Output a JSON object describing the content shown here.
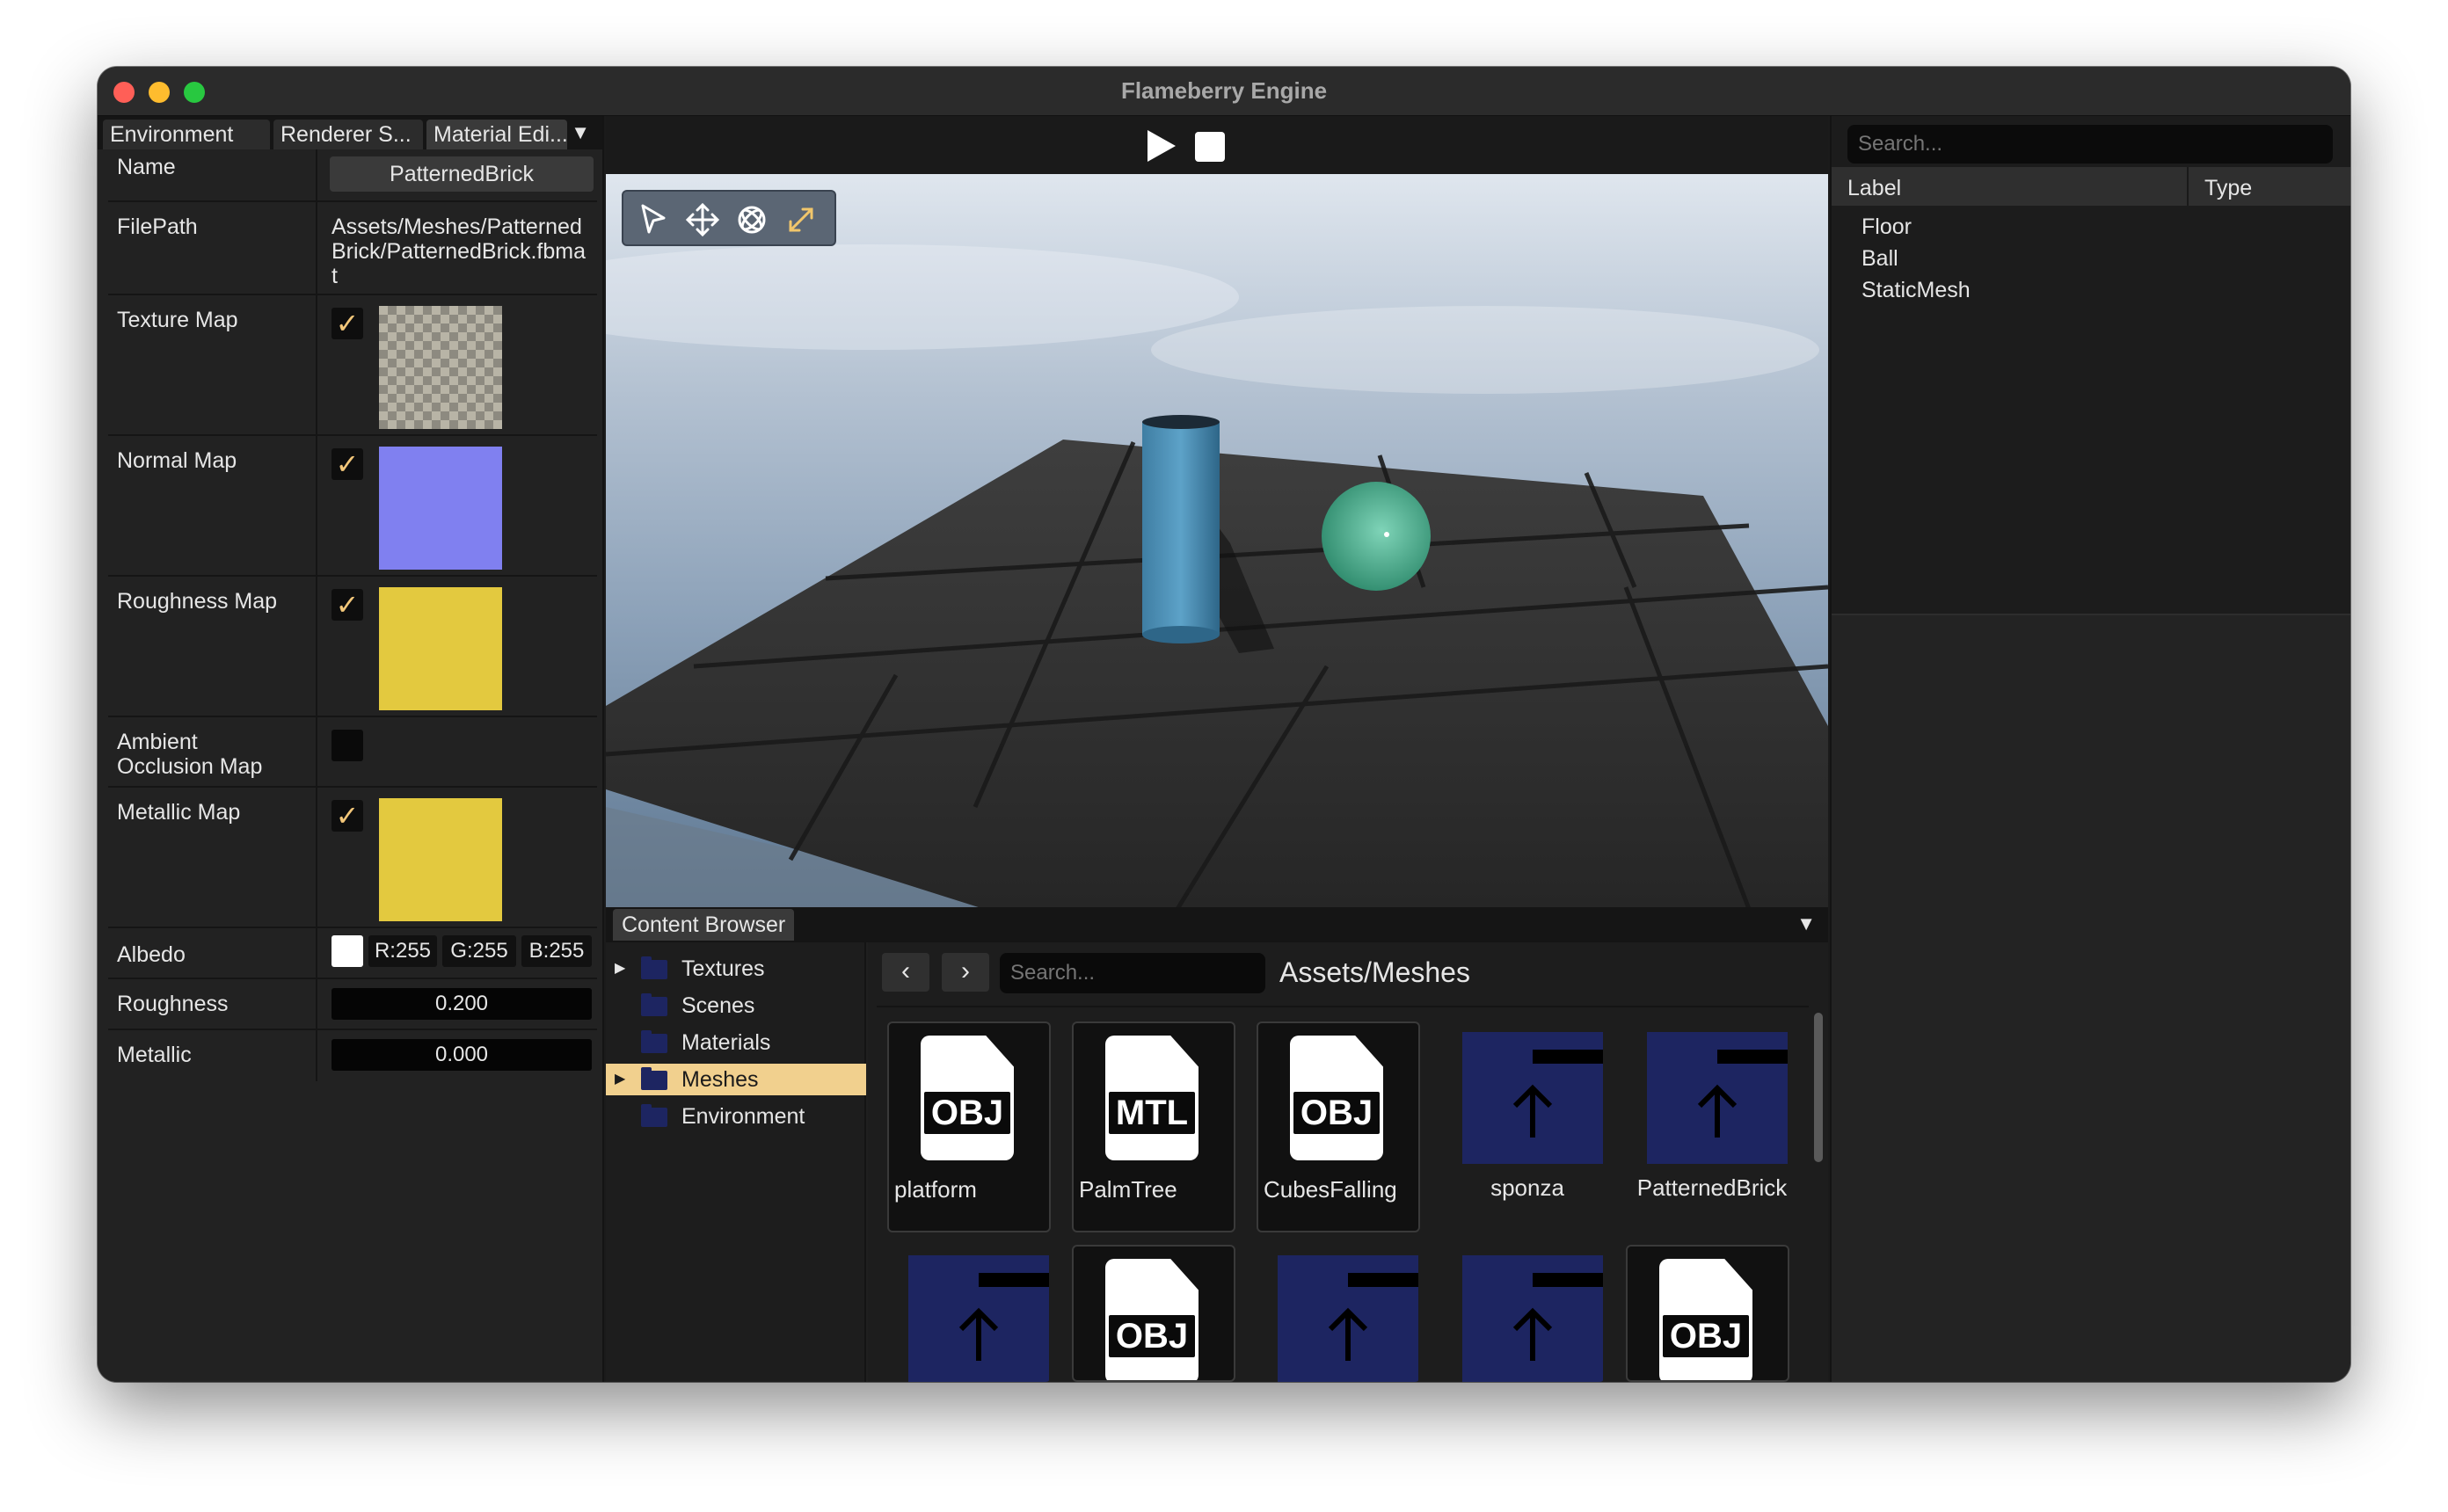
{
  "window": {
    "title": "Flameberry Engine"
  },
  "left_panel": {
    "tabs": [
      "Environment",
      "Renderer S...",
      "Material Edi..."
    ],
    "properties": {
      "name_label": "Name",
      "name_value": "PatternedBrick",
      "filepath_label": "FilePath",
      "filepath_value": "Assets/Meshes/PatternedBrick/PatternedBrick.fbmat",
      "texture_map_label": "Texture Map",
      "normal_map_label": "Normal Map",
      "roughness_map_label": "Roughness Map",
      "ao_map_label": "Ambient Occlusion Map",
      "metallic_map_label": "Metallic Map",
      "albedo_label": "Albedo",
      "albedo_r": "R:255",
      "albedo_g": "G:255",
      "albedo_b": "B:255",
      "roughness_label": "Roughness",
      "roughness_value": "0.200",
      "metallic_label": "Metallic",
      "metallic_value": "0.000"
    },
    "checkmark": "✓",
    "colors": {
      "normal_map": "#8080f0",
      "roughness_map": "#e3c93f",
      "metallic_map": "#e3c93f"
    }
  },
  "viewport": {
    "toolbar": {
      "play_icon": "play-icon",
      "stop_icon": "stop-icon"
    },
    "gizmos": [
      "select-icon",
      "move-icon",
      "rotate-icon",
      "scale-icon"
    ]
  },
  "content_browser": {
    "tab_label": "Content Browser",
    "tree": [
      "Textures",
      "Scenes",
      "Materials",
      "Meshes",
      "Environment"
    ],
    "search_placeholder": "Search...",
    "path": "Assets/Meshes",
    "back_icon": "‹",
    "forward_icon": "›",
    "tiles_row1": [
      {
        "type": "file",
        "ext": "OBJ",
        "label": "platform"
      },
      {
        "type": "file",
        "ext": "MTL",
        "label": "PalmTree"
      },
      {
        "type": "file",
        "ext": "OBJ",
        "label": "CubesFalling"
      },
      {
        "type": "folder",
        "label": "sponza"
      },
      {
        "type": "folder",
        "label": "PatternedBrick"
      }
    ],
    "tiles_row2_ext": [
      "OBJ",
      "OBJ"
    ]
  },
  "right_panel": {
    "search_placeholder": "Search...",
    "col_label": "Label",
    "col_type": "Type",
    "entities": [
      "Floor",
      "Ball",
      "StaticMesh"
    ]
  }
}
